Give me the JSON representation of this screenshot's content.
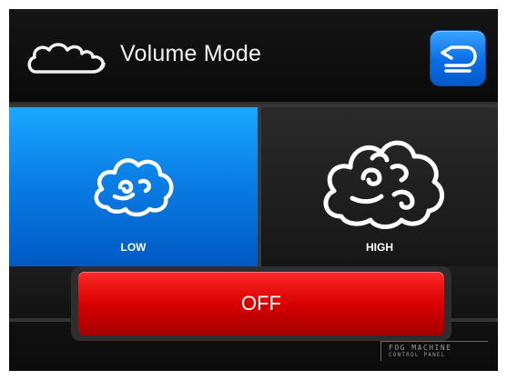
{
  "header": {
    "title": "Volume Mode",
    "mode_icon": "cloud-outline-icon",
    "back_icon": "return-arrow-icon"
  },
  "modes": {
    "low": {
      "label": "LOW",
      "icon": "small-cloud-icon",
      "selected": true
    },
    "high": {
      "label": "HIGH",
      "icon": "large-cloud-icon",
      "selected": false
    }
  },
  "off_button": {
    "label": "OFF"
  },
  "brand": {
    "line1": "FOG MACHINE",
    "line2": "CONTROL PANEL"
  },
  "colors": {
    "selected_blue": "#0a7fe6",
    "off_red": "#d80000",
    "back_button_blue": "#0a6ee8",
    "background": "#0d0d0d"
  }
}
